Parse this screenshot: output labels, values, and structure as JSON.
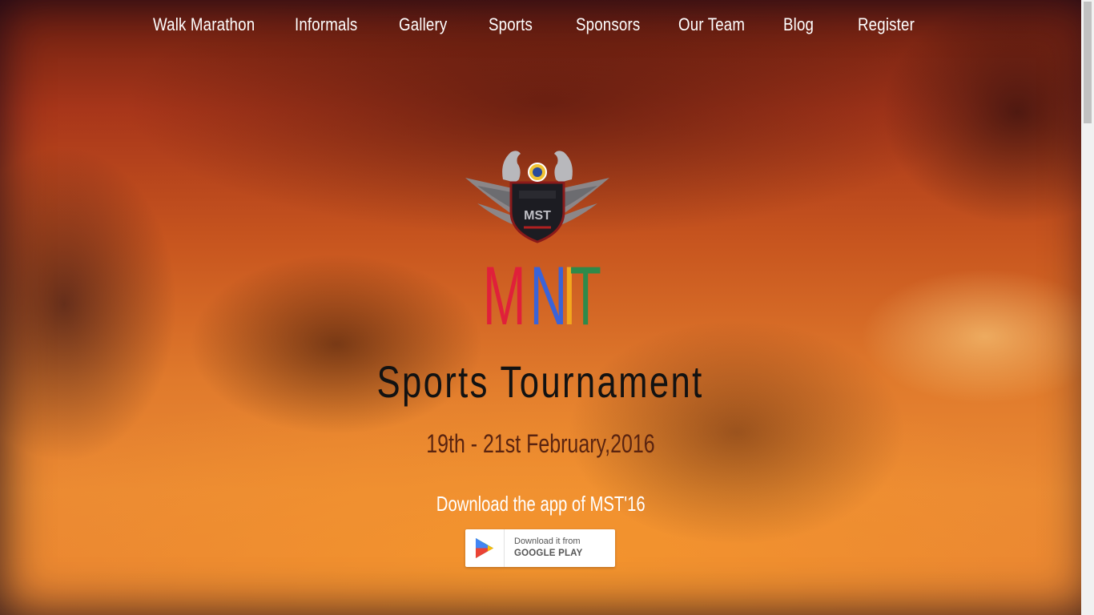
{
  "nav": {
    "items": [
      {
        "label": "Walk Marathon"
      },
      {
        "label": "Informals"
      },
      {
        "label": "Gallery"
      },
      {
        "label": "Sports"
      },
      {
        "label": "Sponsors"
      },
      {
        "label": "Our Team"
      },
      {
        "label": "Blog"
      },
      {
        "label": "Register"
      }
    ]
  },
  "hero": {
    "logo_text": "MST",
    "brand_letters": [
      {
        "char": "M",
        "color": "#e0203a"
      },
      {
        "char": "N",
        "color": "#3a63d8"
      },
      {
        "char": "I",
        "color": "#f2a81d"
      },
      {
        "char": "T",
        "color": "#2e8a4a"
      }
    ],
    "title": "Sports Tournament",
    "date": "19th - 21st February,2016",
    "download_text": "Download the app of MST'16",
    "play_button": {
      "line1": "Download it from",
      "line2": "GOOGLE PLAY",
      "icon": "google-play-icon"
    }
  },
  "colors": {
    "nav_text": "#ffffff",
    "title_text": "#121212",
    "date_text": "#5a2410",
    "accent_orange": "#e07a2c"
  }
}
